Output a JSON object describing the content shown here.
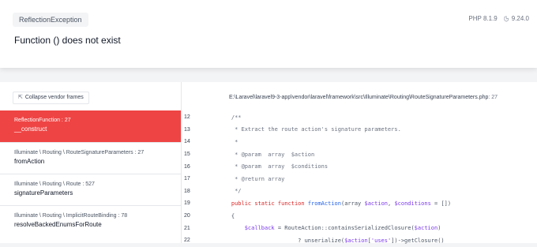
{
  "header": {
    "exception_class": "ReflectionException",
    "message": "Function () does not exist",
    "php_version": "PHP 8.1.9",
    "laravel_version": "9.24.0"
  },
  "sidebar": {
    "collapse_label": "Collapse vendor frames",
    "frames": [
      {
        "class": "ReflectionFunction",
        "line": ": 27",
        "function": "__construct",
        "active": true
      },
      {
        "class": "Illuminate \\ Routing \\ RouteSignatureParameters",
        "line": ": 27",
        "function": "fromAction",
        "active": false
      },
      {
        "class": "Illuminate \\ Routing \\ Route",
        "line": ": 527",
        "function": "signatureParameters",
        "active": false
      },
      {
        "class": "Illuminate \\ Routing \\ ImplicitRouteBinding",
        "line": ": 78",
        "function": "resolveBackedEnumsForRoute",
        "active": false
      }
    ]
  },
  "code": {
    "file_path": "E:\\Laravel\\laravel9-3-app\\vendor\\laravel\\framework\\src\\Illuminate\\Routing\\RouteSignatureParameters.php",
    "file_line": ": 27",
    "lines": [
      {
        "num": "12",
        "text": "    /**"
      },
      {
        "num": "13",
        "text": "     * Extract the route action's signature parameters."
      },
      {
        "num": "14",
        "text": "     *"
      },
      {
        "num": "15",
        "text": "     * @param  array  $action"
      },
      {
        "num": "16",
        "text": "     * @param  array  $conditions"
      },
      {
        "num": "17",
        "text": "     * @return array"
      },
      {
        "num": "18",
        "text": "     */"
      },
      {
        "num": "19",
        "text": "    public static function fromAction(array $action, $conditions = [])"
      },
      {
        "num": "20",
        "text": "    {"
      },
      {
        "num": "21",
        "text": "        $callback = RouteAction::containsSerializedClosure($action)"
      },
      {
        "num": "22",
        "text": "                        ? unserialize($action['uses'])->getClosure()"
      }
    ]
  },
  "colors": {
    "active_frame": "#ef4444",
    "keyword": "#dc2626",
    "function_name": "#2563eb",
    "variable": "#7c3aed"
  }
}
